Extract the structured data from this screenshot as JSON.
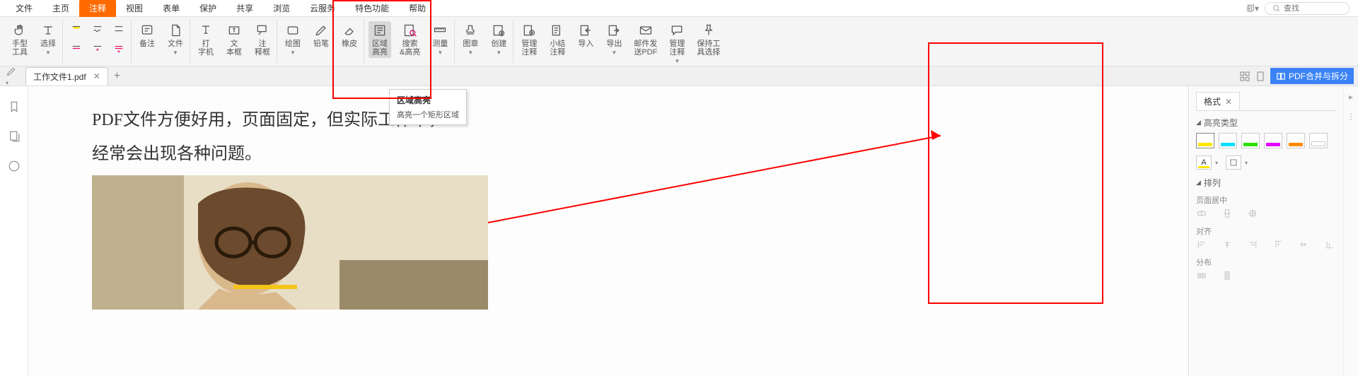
{
  "menu": {
    "items": [
      "文件",
      "主页",
      "注释",
      "视图",
      "表单",
      "保护",
      "共享",
      "浏览",
      "云服务",
      "特色功能",
      "帮助"
    ],
    "active_index": 2,
    "search_placeholder": "查找"
  },
  "ribbon": {
    "hand": "手型\n工具",
    "select": "选择",
    "note": "备注",
    "file": "文件",
    "typewriter": "打\n字机",
    "textbox": "文\n本框",
    "callout": "注\n释框",
    "draw": "绘图",
    "pencil": "铅笔",
    "eraser": "橡皮",
    "area_highlight": "区域\n高亮",
    "search_highlight": "搜索\n&高亮",
    "measure": "测量",
    "stamp": "图章",
    "create": "创建",
    "manage_notes": "管理\n注释",
    "summary_notes": "小结\n注释",
    "import": "导入",
    "export": "导出",
    "mail_pdf": "邮件发\n送PDF",
    "manage_tools": "管理\n注释",
    "keep_tool": "保持工\n具选择"
  },
  "tabs": {
    "doc1": "工作文件1.pdf",
    "merge_btn": "PDF合并与拆分"
  },
  "doc": {
    "line1": "PDF文件方便好用，页面固定，但实际工作中，",
    "line2": "经常会出现各种问题。"
  },
  "tooltip": {
    "title": "区域高亮",
    "body": "高亮一个矩形区域"
  },
  "panel": {
    "tab": "格式",
    "section_highlight": "高亮类型",
    "section_arrange": "排列",
    "center_page": "页面居中",
    "align": "对齐",
    "distribute": "分布"
  }
}
